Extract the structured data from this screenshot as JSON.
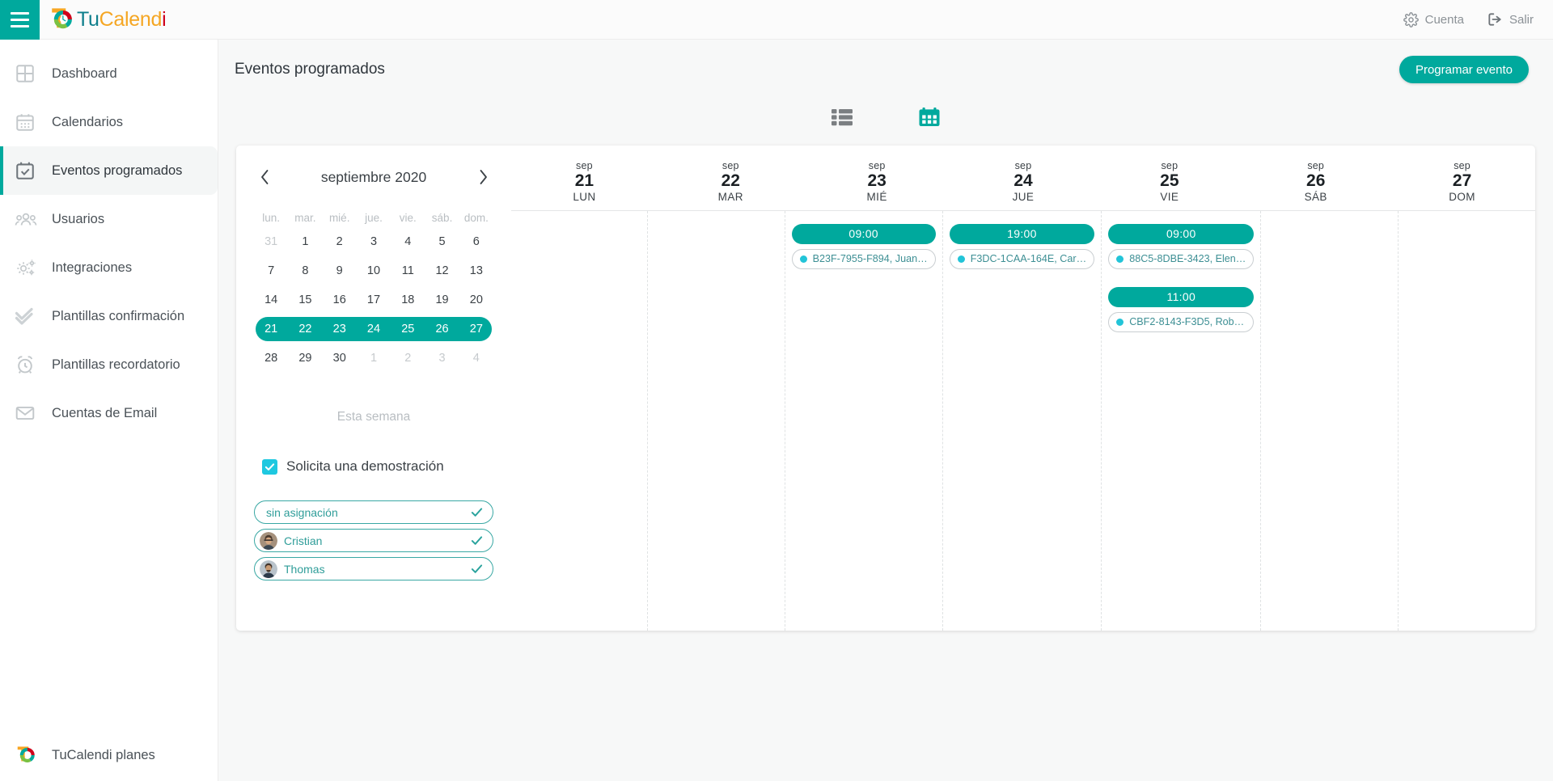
{
  "topbar": {
    "menu_icon": "hamburger-icon",
    "brand": {
      "part1": "Tu",
      "part2": "Calend",
      "part3": "i"
    },
    "account_label": "Cuenta",
    "logout_label": "Salir"
  },
  "sidebar": {
    "items": [
      {
        "label": "Dashboard",
        "icon": "grid-icon",
        "active": false
      },
      {
        "label": "Calendarios",
        "icon": "calendar-icon",
        "active": false
      },
      {
        "label": "Eventos programados",
        "icon": "calendar-check-icon",
        "active": true
      },
      {
        "label": "Usuarios",
        "icon": "users-icon",
        "active": false
      },
      {
        "label": "Integraciones",
        "icon": "gears-icon",
        "active": false
      },
      {
        "label": "Plantillas confirmación",
        "icon": "double-check-icon",
        "active": false
      },
      {
        "label": "Plantillas recordatorio",
        "icon": "alarm-clock-icon",
        "active": false
      },
      {
        "label": "Cuentas de Email",
        "icon": "envelope-icon",
        "active": false
      }
    ],
    "bottom": {
      "label": "TuCalendi planes",
      "icon": "tucalendi-logo-icon"
    }
  },
  "page": {
    "title": "Eventos programados",
    "primary_button": "Programar evento"
  },
  "view_toggle": {
    "list_label": "list-view",
    "calendar_label": "calendar-view",
    "active": "calendar"
  },
  "mini_calendar": {
    "title": "septiembre 2020",
    "prev_label": "‹",
    "next_label": "›",
    "dow": [
      "lun.",
      "mar.",
      "mié.",
      "jue.",
      "vie.",
      "sáb.",
      "dom."
    ],
    "weeks": [
      {
        "selected": false,
        "days": [
          {
            "n": "31",
            "muted": true
          },
          {
            "n": "1",
            "muted": false
          },
          {
            "n": "2",
            "muted": false
          },
          {
            "n": "3",
            "muted": false
          },
          {
            "n": "4",
            "muted": false
          },
          {
            "n": "5",
            "muted": false
          },
          {
            "n": "6",
            "muted": false
          }
        ]
      },
      {
        "selected": false,
        "days": [
          {
            "n": "7",
            "muted": false
          },
          {
            "n": "8",
            "muted": false
          },
          {
            "n": "9",
            "muted": false
          },
          {
            "n": "10",
            "muted": false
          },
          {
            "n": "11",
            "muted": false
          },
          {
            "n": "12",
            "muted": false
          },
          {
            "n": "13",
            "muted": false
          }
        ]
      },
      {
        "selected": false,
        "days": [
          {
            "n": "14",
            "muted": false
          },
          {
            "n": "15",
            "muted": false
          },
          {
            "n": "16",
            "muted": false
          },
          {
            "n": "17",
            "muted": false
          },
          {
            "n": "18",
            "muted": false
          },
          {
            "n": "19",
            "muted": false
          },
          {
            "n": "20",
            "muted": false
          }
        ]
      },
      {
        "selected": true,
        "days": [
          {
            "n": "21",
            "muted": false
          },
          {
            "n": "22",
            "muted": false
          },
          {
            "n": "23",
            "muted": false
          },
          {
            "n": "24",
            "muted": false
          },
          {
            "n": "25",
            "muted": false
          },
          {
            "n": "26",
            "muted": false
          },
          {
            "n": "27",
            "muted": false
          }
        ]
      },
      {
        "selected": false,
        "days": [
          {
            "n": "28",
            "muted": false
          },
          {
            "n": "29",
            "muted": false
          },
          {
            "n": "30",
            "muted": false
          },
          {
            "n": "1",
            "muted": true
          },
          {
            "n": "2",
            "muted": true
          },
          {
            "n": "3",
            "muted": true
          },
          {
            "n": "4",
            "muted": true
          }
        ]
      }
    ],
    "this_week_label": "Esta semana"
  },
  "filters": {
    "demo_checkbox": {
      "label": "Solicita una demostración",
      "checked": true
    },
    "pills": [
      {
        "label": "sin asignación",
        "has_avatar": false,
        "checked": true
      },
      {
        "label": "Cristian",
        "has_avatar": true,
        "checked": true
      },
      {
        "label": "Thomas",
        "has_avatar": true,
        "checked": true
      }
    ]
  },
  "week_view": {
    "days": [
      {
        "month": "sep",
        "num": "21",
        "dow": "LUN",
        "events": []
      },
      {
        "month": "sep",
        "num": "22",
        "dow": "MAR",
        "events": []
      },
      {
        "month": "sep",
        "num": "23",
        "dow": "MIÉ",
        "events": [
          {
            "time": "09:00",
            "title": "B23F-7955-F894, Juan…"
          }
        ]
      },
      {
        "month": "sep",
        "num": "24",
        "dow": "JUE",
        "events": [
          {
            "time": "19:00",
            "title": "F3DC-1CAA-164E, Car…"
          }
        ]
      },
      {
        "month": "sep",
        "num": "25",
        "dow": "VIE",
        "events": [
          {
            "time": "09:00",
            "title": "88C5-8DBE-3423, Elen…"
          },
          {
            "time": "11:00",
            "title": "CBF2-8143-F3D5, Rob…"
          }
        ]
      },
      {
        "month": "sep",
        "num": "26",
        "dow": "SÁB",
        "events": []
      },
      {
        "month": "sep",
        "num": "27",
        "dow": "DOM",
        "events": []
      }
    ]
  },
  "colors": {
    "teal": "#00a99d",
    "cyan": "#1ec8e0",
    "pill_text": "#2f9d99",
    "sidebar_text": "#4a5157"
  }
}
